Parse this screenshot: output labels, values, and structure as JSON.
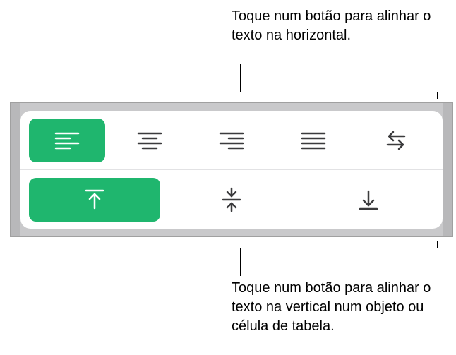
{
  "callouts": {
    "top": "Toque num botão para alinhar o texto na horizontal.",
    "bottom": "Toque num botão para alinhar o texto na vertical num objeto ou célula de tabela."
  },
  "alignment": {
    "horizontal": {
      "options": [
        "left",
        "center",
        "right",
        "justify",
        "direction"
      ],
      "selected": "left"
    },
    "vertical": {
      "options": [
        "top",
        "middle",
        "bottom"
      ],
      "selected": "top"
    }
  },
  "colors": {
    "accent": "#1fb66e"
  }
}
